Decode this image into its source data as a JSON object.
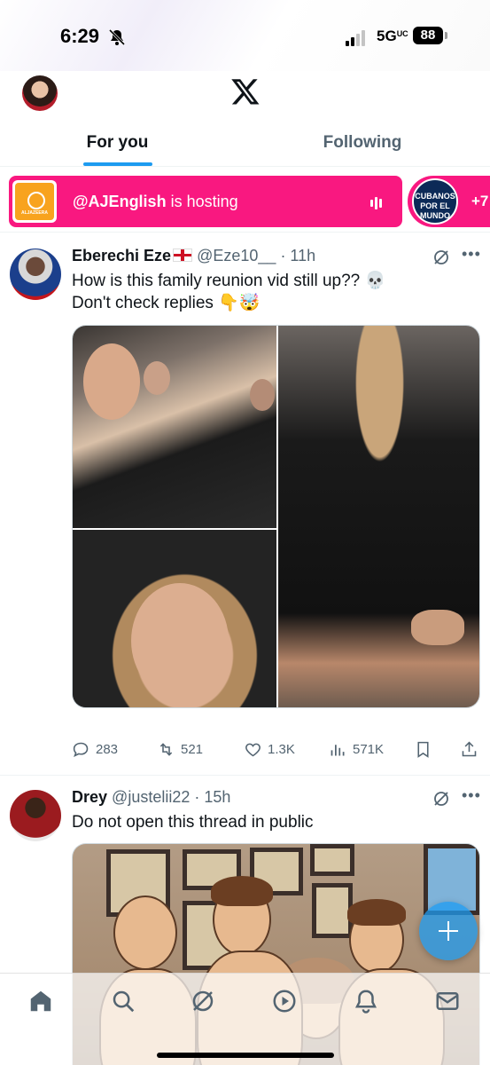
{
  "status_bar": {
    "time": "6:29",
    "network": "5G",
    "network_suffix": "UC",
    "battery": "88"
  },
  "header": {
    "logo": "x-logo",
    "tabs": [
      {
        "label": "For you",
        "active": true
      },
      {
        "label": "Following",
        "active": false
      }
    ]
  },
  "spaces": {
    "host_handle": "@AJEnglish",
    "host_suffix": " is hosting",
    "second_logo_text": "CUBANOS POR EL MUNDO",
    "more_count": "+7",
    "accent_color": "#f91880"
  },
  "tweets": [
    {
      "name": "Eberechi Eze",
      "flag_icon": "england-flag-icon",
      "handle": "@Eze10__",
      "time": "· 11h",
      "text": "How is this family reunion vid still up?? 💀\nDon't check replies 👇🤯",
      "replies": "283",
      "retweets": "521",
      "likes": "1.3K",
      "views": "571K"
    },
    {
      "name": "Drey",
      "handle": "@justelii22",
      "time": "· 15h",
      "text": "Do not open this thread in public"
    }
  ],
  "bottom_nav": [
    "home-icon",
    "search-icon",
    "grok-icon",
    "video-icon",
    "notifications-icon",
    "messages-icon"
  ],
  "colors": {
    "accent": "#1d9bf0",
    "text": "#0f1419",
    "secondary": "#536471"
  }
}
